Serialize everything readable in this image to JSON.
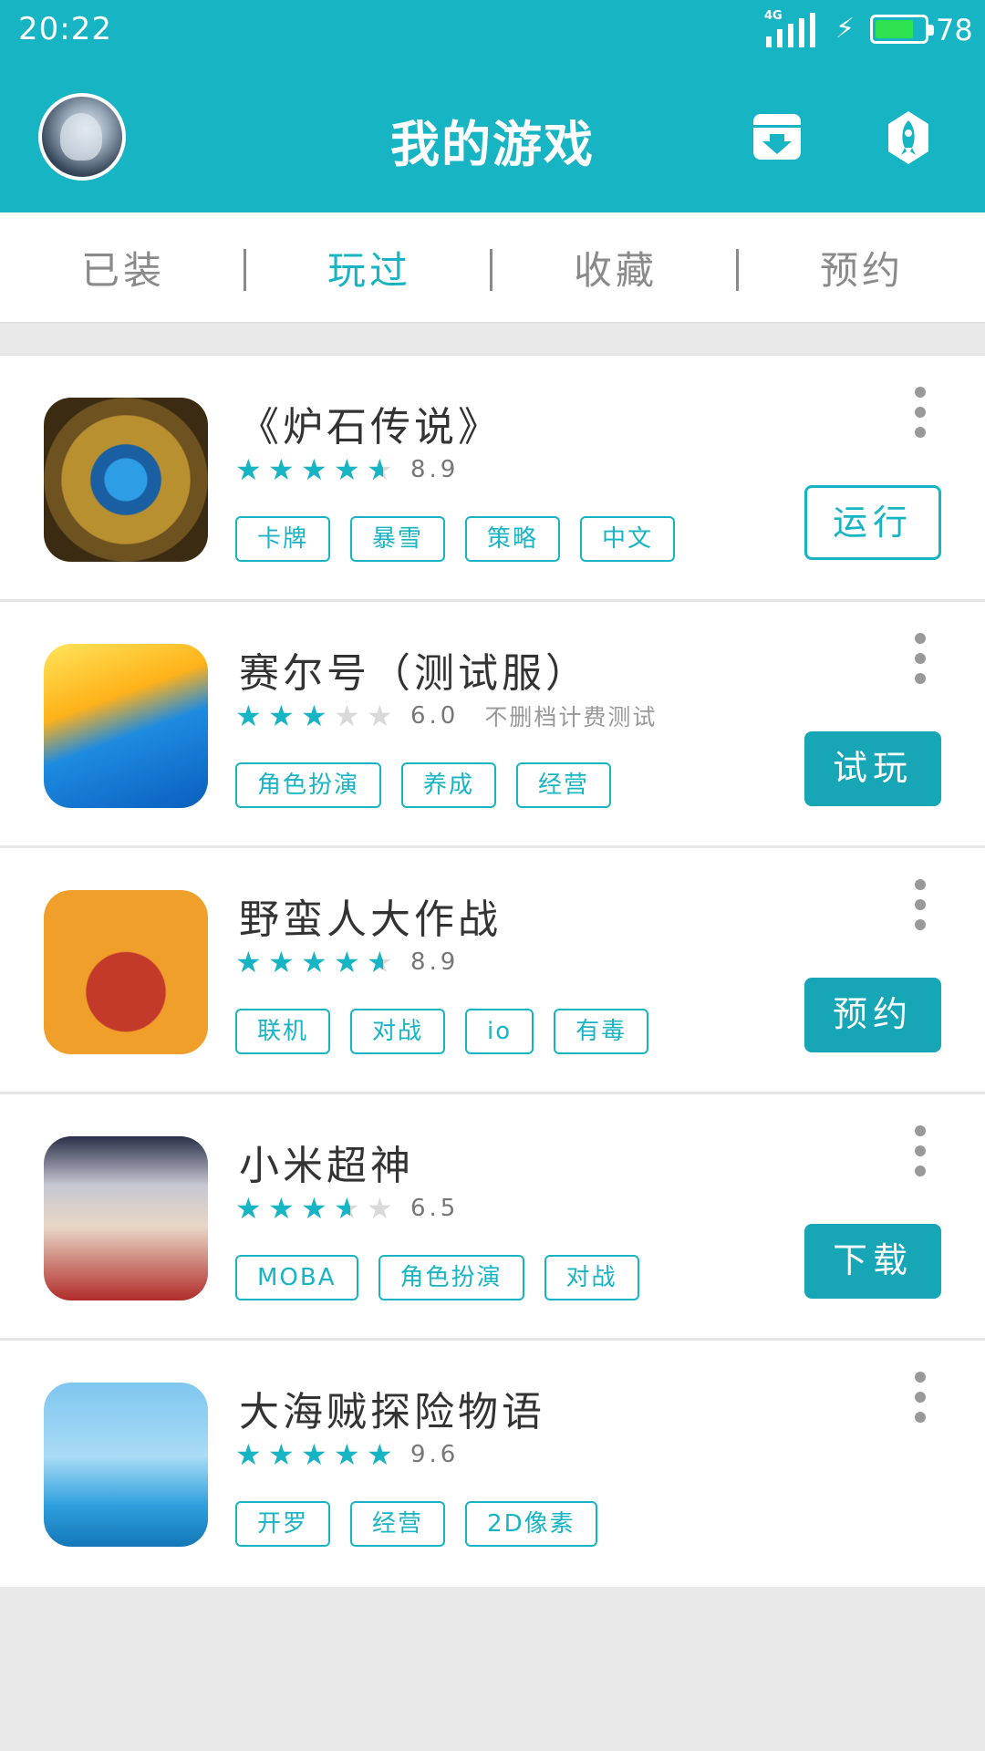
{
  "status": {
    "time": "20:22",
    "network": "4G",
    "battery_percent": "78",
    "battery_level": 0.78
  },
  "header": {
    "title": "我的游戏"
  },
  "tabs": [
    {
      "label": "已装",
      "active": false
    },
    {
      "label": "玩过",
      "active": true
    },
    {
      "label": "收藏",
      "active": false
    },
    {
      "label": "预约",
      "active": false
    }
  ],
  "games": [
    {
      "name": "《炉石传说》",
      "rating": 8.9,
      "stars": 4.5,
      "score": "8.9",
      "note": "",
      "tags": [
        "卡牌",
        "暴雪",
        "策略",
        "中文"
      ],
      "action": "运行",
      "action_style": "outline",
      "icon": "hearthstone-icon"
    },
    {
      "name": "赛尔号（测试服）",
      "rating": 6.0,
      "stars": 3,
      "score": "6.0",
      "note": "不删档计费测试",
      "tags": [
        "角色扮演",
        "养成",
        "经营"
      ],
      "action": "试玩",
      "action_style": "filled",
      "icon": "seer-icon"
    },
    {
      "name": "野蛮人大作战",
      "rating": 8.9,
      "stars": 4.5,
      "score": "8.9",
      "note": "",
      "tags": [
        "联机",
        "对战",
        "io",
        "有毒"
      ],
      "action": "预约",
      "action_style": "filled",
      "icon": "barbarian-icon"
    },
    {
      "name": "小米超神",
      "rating": 6.5,
      "stars": 3.5,
      "score": "6.5",
      "note": "",
      "tags": [
        "MOBA",
        "角色扮演",
        "对战"
      ],
      "action": "下载",
      "action_style": "filled",
      "icon": "mi-superhero-icon"
    },
    {
      "name": "大海贼探险物语",
      "rating": 9.6,
      "stars": 5,
      "score": "9.6",
      "note": "",
      "tags": [
        "开罗",
        "经营",
        "2D像素"
      ],
      "action": "",
      "action_style": "none",
      "icon": "pirate-adventure-icon"
    }
  ],
  "colors": {
    "accent": "#17b4c4",
    "button": "#17a6b6",
    "background": "#e9e9e9"
  }
}
